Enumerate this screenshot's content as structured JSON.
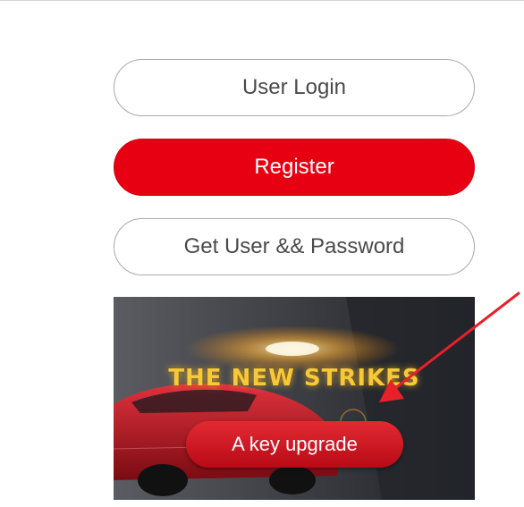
{
  "buttons": {
    "login_label": "User Login",
    "register_label": "Register",
    "get_password_label": "Get User && Password"
  },
  "banner": {
    "headline": "THE NEW STRIKES",
    "cta_label": "A key upgrade"
  },
  "colors": {
    "accent": "#e60012",
    "outline": "#a9a9a9",
    "annotation_arrow": "#e8202a"
  },
  "icons": {
    "annotation": "red-arrow-icon"
  }
}
